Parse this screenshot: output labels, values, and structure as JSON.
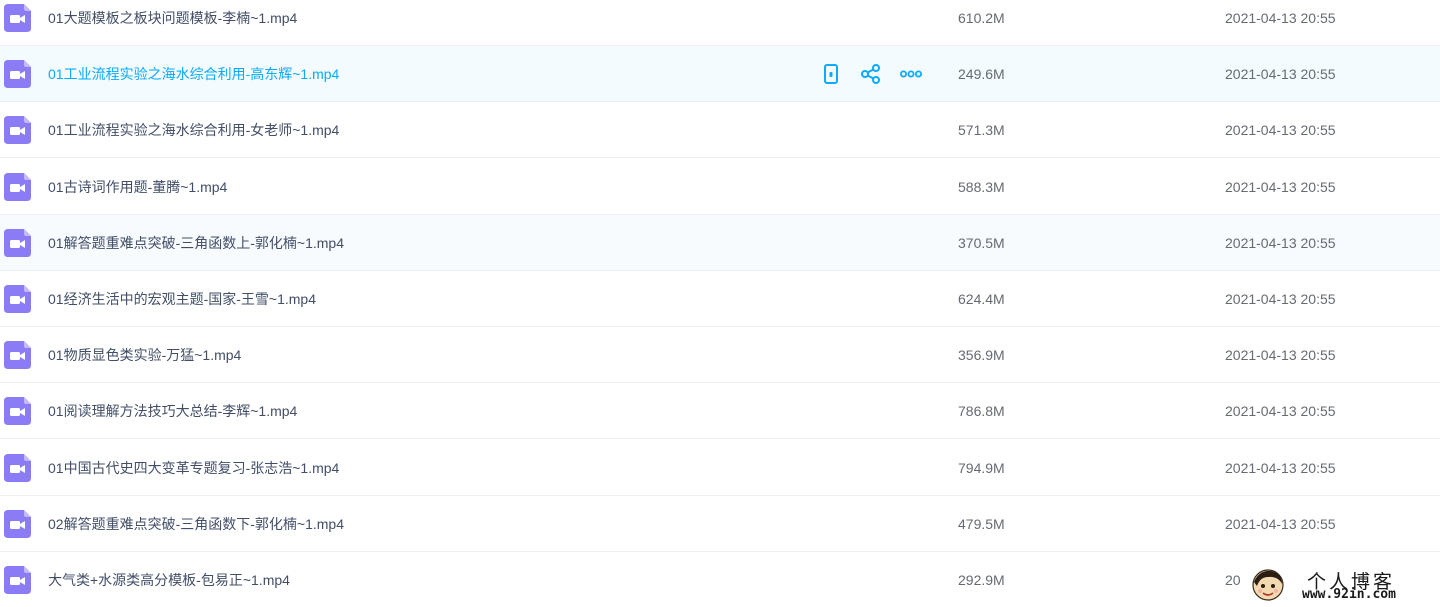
{
  "files": [
    {
      "name": "01大题模板之板块问题模板-李楠~1.mp4",
      "size": "610.2M",
      "date": "2021-04-13 20:55",
      "icon": "video-file-icon"
    },
    {
      "name": "01工业流程实验之海水综合利用-高东辉~1.mp4",
      "size": "249.6M",
      "date": "2021-04-13 20:55",
      "icon": "video-file-icon",
      "hovered": true
    },
    {
      "name": "01工业流程实验之海水综合利用-女老师~1.mp4",
      "size": "571.3M",
      "date": "2021-04-13 20:55",
      "icon": "video-file-icon"
    },
    {
      "name": "01古诗词作用题-董腾~1.mp4",
      "size": "588.3M",
      "date": "2021-04-13 20:55",
      "icon": "video-file-icon"
    },
    {
      "name": "01解答题重难点突破-三角函数上-郭化楠~1.mp4",
      "size": "370.5M",
      "date": "2021-04-13 20:55",
      "icon": "video-file-icon"
    },
    {
      "name": "01经济生活中的宏观主题-国家-王雪~1.mp4",
      "size": "624.4M",
      "date": "2021-04-13 20:55",
      "icon": "video-file-icon"
    },
    {
      "name": "01物质显色类实验-万猛~1.mp4",
      "size": "356.9M",
      "date": "2021-04-13 20:55",
      "icon": "video-file-icon"
    },
    {
      "name": "01阅读理解方法技巧大总结-李辉~1.mp4",
      "size": "786.8M",
      "date": "2021-04-13 20:55",
      "icon": "video-file-icon"
    },
    {
      "name": "01中国古代史四大变革专题复习-张志浩~1.mp4",
      "size": "794.9M",
      "date": "2021-04-13 20:55",
      "icon": "video-file-icon"
    },
    {
      "name": "02解答题重难点突破-三角函数下-郭化楠~1.mp4",
      "size": "479.5M",
      "date": "2021-04-13 20:55",
      "icon": "video-file-icon"
    },
    {
      "name": "大气类+水源类高分模板-包易正~1.mp4",
      "size": "292.9M",
      "date": "20",
      "icon": "video-file-icon"
    }
  ],
  "hover_actions": [
    {
      "name": "phone-icon",
      "label": ""
    },
    {
      "name": "share-icon",
      "label": ""
    },
    {
      "name": "more-icon",
      "label": ""
    }
  ],
  "watermark": {
    "title": "个人博客",
    "url": "www.92in.com"
  },
  "colors": {
    "accent": "#09aaff",
    "icon_purple": "#8b7cf6",
    "text": "#424e67",
    "muted": "#666a72",
    "hover_bg": "#f4fbff"
  }
}
